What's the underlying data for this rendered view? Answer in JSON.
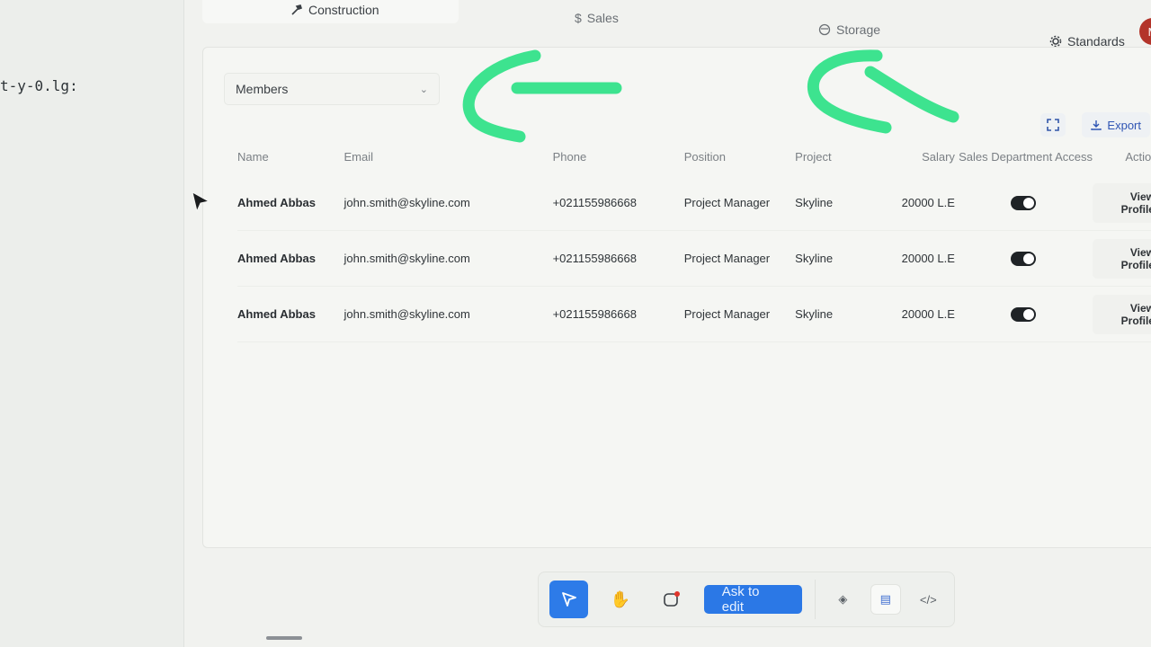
{
  "editor": {
    "code_fragment": "t-y-0.lg:"
  },
  "tabs": [
    {
      "label": "Construction",
      "icon": "hammer-icon"
    },
    {
      "label": "Sales",
      "icon": "dollar-icon"
    },
    {
      "label": "Storage",
      "icon": "storage-icon"
    },
    {
      "label": "Standards",
      "icon": "gear-icon"
    }
  ],
  "avatar": {
    "initial": "M"
  },
  "filter": {
    "selected": "Members"
  },
  "toolbar": {
    "export_label": "Export"
  },
  "table": {
    "headers": [
      "Name",
      "Email",
      "Phone",
      "Position",
      "Project",
      "Salary",
      "Sales Department Access",
      "Actions"
    ],
    "rows": [
      {
        "name": "Ahmed Abbas",
        "email": "john.smith@skyline.com",
        "phone": "+021155986668",
        "position": "Project Manager",
        "project": "Skyline",
        "salary": "20000 L.E",
        "action": "View Profile"
      },
      {
        "name": "Ahmed Abbas",
        "email": "john.smith@skyline.com",
        "phone": "+021155986668",
        "position": "Project Manager",
        "project": "Skyline",
        "salary": "20000 L.E",
        "action": "View Profile"
      },
      {
        "name": "Ahmed Abbas",
        "email": "john.smith@skyline.com",
        "phone": "+021155986668",
        "position": "Project Manager",
        "project": "Skyline",
        "salary": "20000 L.E",
        "action": "View Profile"
      }
    ]
  },
  "bottom_toolbar": {
    "ask_label": "Ask to edit"
  },
  "colors": {
    "accent": "#2b78e6",
    "annotation": "#3de38f",
    "avatar": "#b3342a"
  }
}
